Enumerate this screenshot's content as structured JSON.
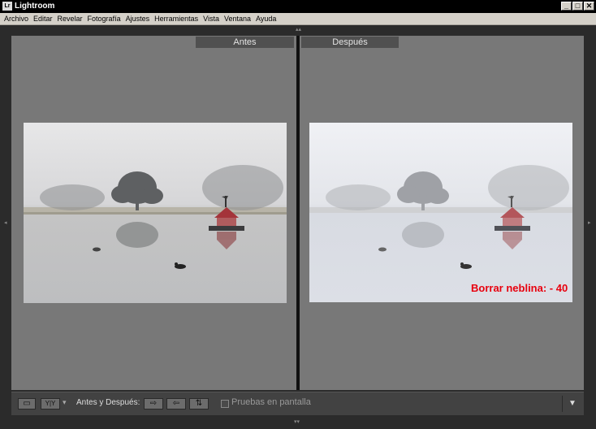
{
  "window": {
    "icon_text": "Lr",
    "title": "Lightroom",
    "minimize": "_",
    "maximize": "□",
    "close": "✕"
  },
  "menu": [
    "Archivo",
    "Editar",
    "Revelar",
    "Fotografía",
    "Ajustes",
    "Herramientas",
    "Vista",
    "Ventana",
    "Ayuda"
  ],
  "panes": {
    "before_label": "Antes",
    "after_label": "Después"
  },
  "overlay": {
    "text": "Borrar neblina: - 40",
    "color": "#e8000e"
  },
  "toolbar": {
    "loupe_icon": "▭",
    "compare_icon": "Y|Y",
    "dropdown_icon": "▾",
    "label": "Antes y Después:",
    "copy_before_icon": "⇨",
    "copy_after_icon": "⇦",
    "swap_icon": "⇅",
    "proof_label": "Pruebas en pantalla",
    "menu_icon": "▼"
  }
}
